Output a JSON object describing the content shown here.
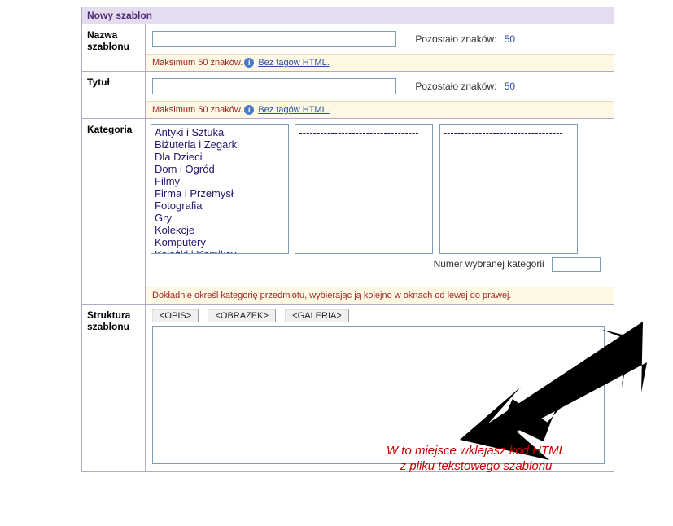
{
  "header": {
    "title": "Nowy szablon"
  },
  "name": {
    "label": "Nazwa szablonu",
    "value": "",
    "counter_label": "Pozostało znaków:",
    "counter_value": "50",
    "hint_prefix": "Maksimum 50 znaków.",
    "hint_link": "Bez tagów HTML."
  },
  "title": {
    "label": "Tytuł",
    "value": "",
    "counter_label": "Pozostało znaków:",
    "counter_value": "50",
    "hint_prefix": "Maksimum 50 znaków.",
    "hint_link": "Bez tagów HTML."
  },
  "category": {
    "label": "Kategoria",
    "col1": [
      "Antyki i Sztuka",
      "Biżuteria i Zegarki",
      "Dla Dzieci",
      "Dom i Ogród",
      "Filmy",
      "Firma i Przemysł",
      "Fotografia",
      "Gry",
      "Kolekcje",
      "Komputery",
      "Książki i Komiksy"
    ],
    "col2_placeholder": "----------------------------------",
    "col3_placeholder": "----------------------------------",
    "num_label": "Numer wybranej kategorii",
    "num_value": "",
    "hint": "Dokładnie określ kategorię przedmiotu, wybierając ją kolejno w oknach od lewej do prawej."
  },
  "structure": {
    "label": "Struktura szablonu",
    "btn_opis": "<OPIS>",
    "btn_obrazek": "<OBRAZEK>",
    "btn_galeria": "<GALERIA>",
    "textarea_value": "",
    "annotation_line1": "W to miejsce wklejasz kod HTML",
    "annotation_line2": "z pliku tekstowego szablonu"
  }
}
